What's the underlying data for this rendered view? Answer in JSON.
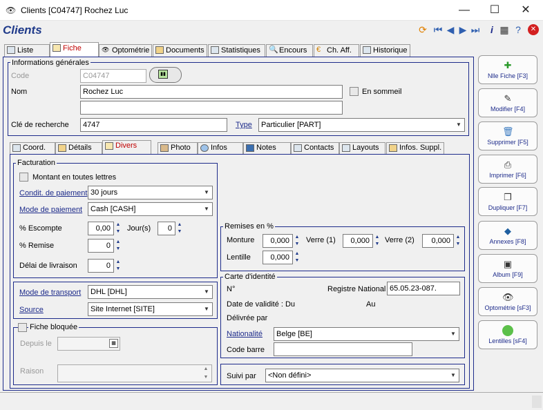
{
  "window": {
    "title": "Clients  [C04747] Rochez Luc",
    "min": "—",
    "max": "☐",
    "close": "✕"
  },
  "app": {
    "title": "Clients"
  },
  "main_tabs": [
    "Liste",
    "Fiche",
    "Optométrie",
    "Documents",
    "Statistiques",
    "Encours",
    "Ch. Aff.",
    "Historique"
  ],
  "general": {
    "legend": "Informations générales",
    "code_label": "Code",
    "code_value": "C04747",
    "nom_label": "Nom",
    "nom_value": "Rochez Luc",
    "nom2_value": "",
    "sommeil_label": "En sommeil",
    "cle_label": "Clé de recherche",
    "cle_value": "4747",
    "type_label": "Type",
    "type_value": "Particulier [PART]"
  },
  "sub_tabs": [
    "Coord.",
    "Détails",
    "Divers",
    "Photo",
    "Infos",
    "Notes",
    "Contacts",
    "Layouts",
    "Infos. Suppl."
  ],
  "facturation": {
    "legend": "Facturation",
    "montant_label": "Montant en toutes lettres",
    "cond_label": "Condit. de paiement",
    "cond_value": "30 jours",
    "mode_label": "Mode de paiement",
    "mode_value": "Cash [CASH]",
    "escompte_label": "% Escompte",
    "escompte_value": "0,00",
    "jours_label": "Jour(s)",
    "jours_value": "0",
    "remise_label": "% Remise",
    "remise_value": "0",
    "delai_label": "Délai de livraison",
    "delai_value": "0"
  },
  "transport": {
    "mode_label": "Mode de transport",
    "mode_value": "DHL [DHL]",
    "source_label": "Source",
    "source_value": "Site Internet [SITE]"
  },
  "bloquee": {
    "legend": "Fiche bloquée",
    "depuis_label": "Depuis le",
    "depuis_value": "",
    "raison_label": "Raison",
    "raison_value": ""
  },
  "remises": {
    "legend": "Remises en %",
    "monture_label": "Monture",
    "monture_value": "0,000",
    "verre1_label": "Verre (1)",
    "verre1_value": "0,000",
    "verre2_label": "Verre (2)",
    "verre2_value": "0,000",
    "lentille_label": "Lentille",
    "lentille_value": "0,000"
  },
  "carte": {
    "legend": "Carte d'identité",
    "no_label": "N°",
    "registre_label": "Registre National",
    "registre_value": "65.05.23-087.",
    "validite_label": "Date de validité : Du",
    "au_label": "Au",
    "delivree_label": "Délivrée par",
    "nationalite_label": "Nationalité",
    "nationalite_value": "Belge [BE]",
    "codebarre_label": "Code barre",
    "codebarre_value": ""
  },
  "suivi": {
    "label": "Suivi par",
    "value": "<Non défini>"
  },
  "side_buttons": [
    "Nlle Fiche [F3]",
    "Modifier [F4]",
    "Supprimer [F5]",
    "Imprimer [F6]",
    "Dupliquer [F7]",
    "Annexes [F8]",
    "Album [F9]",
    "Optométrie [sF3]",
    "Lentilles [sF4]"
  ]
}
